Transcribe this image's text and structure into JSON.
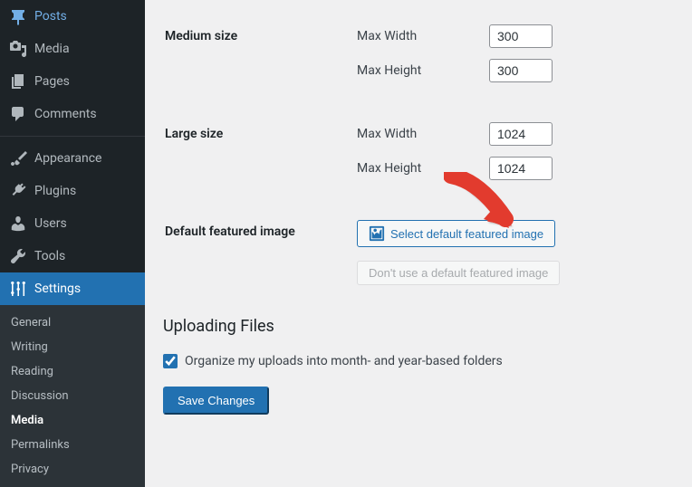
{
  "sidebar": {
    "items": [
      {
        "label": "Posts"
      },
      {
        "label": "Media"
      },
      {
        "label": "Pages"
      },
      {
        "label": "Comments"
      },
      {
        "label": "Appearance"
      },
      {
        "label": "Plugins"
      },
      {
        "label": "Users"
      },
      {
        "label": "Tools"
      },
      {
        "label": "Settings"
      }
    ],
    "submenu": [
      {
        "label": "General"
      },
      {
        "label": "Writing"
      },
      {
        "label": "Reading"
      },
      {
        "label": "Discussion"
      },
      {
        "label": "Media"
      },
      {
        "label": "Permalinks"
      },
      {
        "label": "Privacy"
      }
    ]
  },
  "form": {
    "medium_size_label": "Medium size",
    "large_size_label": "Large size",
    "default_featured_label": "Default featured image",
    "max_width_label": "Max Width",
    "max_height_label": "Max Height",
    "medium_width": "300",
    "medium_height": "300",
    "large_width": "1024",
    "large_height": "1024",
    "select_btn": "Select default featured image",
    "dont_use_btn": "Don't use a default featured image",
    "section_title": "Uploading Files",
    "organize_label": "Organize my uploads into month- and year-based folders",
    "save_btn": "Save Changes"
  }
}
